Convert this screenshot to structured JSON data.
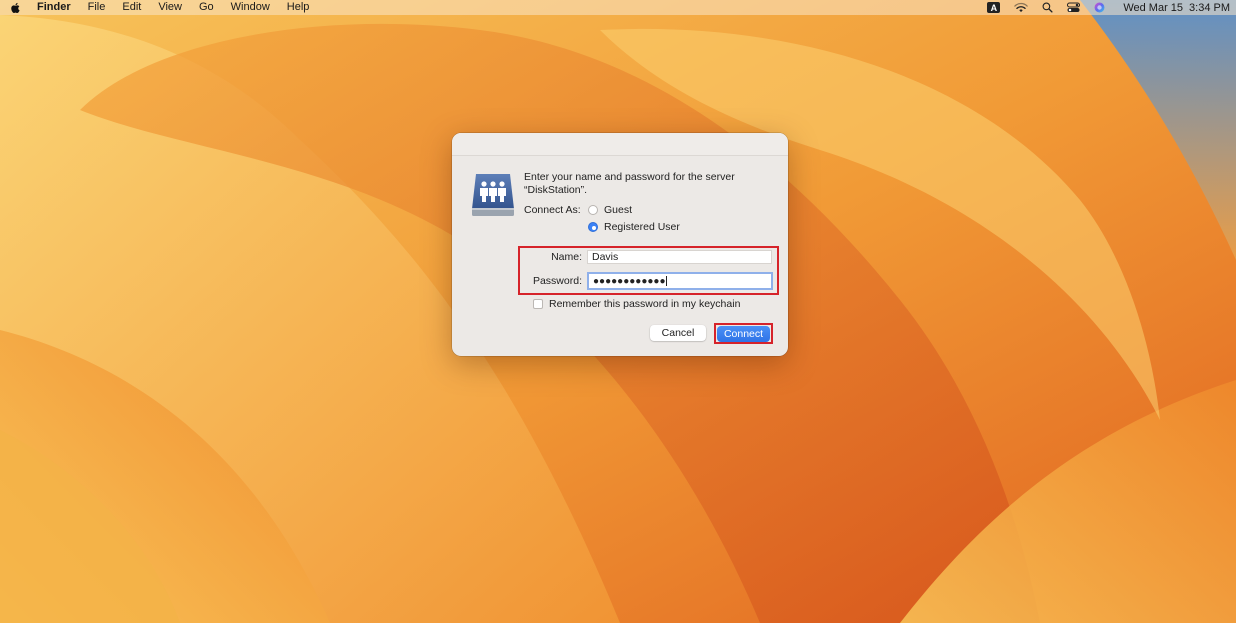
{
  "menubar": {
    "apple_icon": "apple-icon",
    "items": [
      "Finder",
      "File",
      "Edit",
      "View",
      "Go",
      "Window",
      "Help"
    ],
    "input_source": "A",
    "clock_date": "Wed Mar 15",
    "clock_time": "3:34 PM",
    "tray_icons": [
      "wifi-icon",
      "spotlight-search-icon",
      "control-center-icon",
      "siri-icon"
    ]
  },
  "dialog": {
    "icon": "shared-server-icon",
    "prompt": "Enter your name and password for the server “DiskStation”.",
    "connect_as_label": "Connect As:",
    "options": [
      {
        "label": "Guest",
        "selected": false
      },
      {
        "label": "Registered User",
        "selected": true
      }
    ],
    "name_label": "Name:",
    "name_value": "Davis",
    "password_label": "Password:",
    "password_value": "●●●●●●●●●●●●",
    "remember_label": "Remember this password in my keychain",
    "remember_checked": false,
    "cancel_label": "Cancel",
    "connect_label": "Connect"
  },
  "colors": {
    "accent": "#3b82f6",
    "highlight": "#d6232a"
  }
}
